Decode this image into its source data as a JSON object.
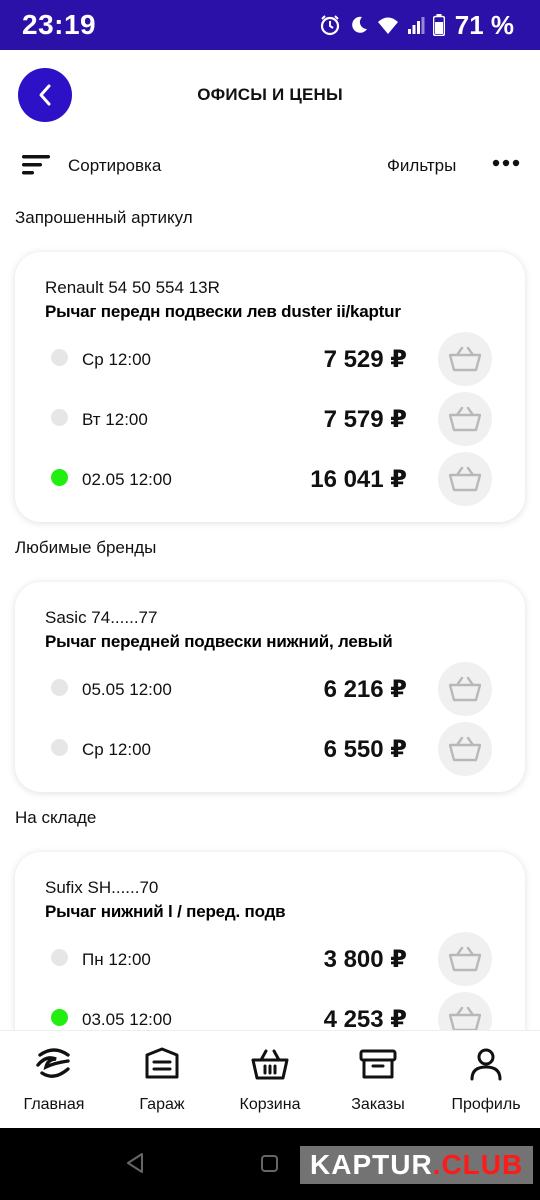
{
  "status_bar": {
    "time": "23:19",
    "battery_percent": "71 %"
  },
  "header": {
    "title": "ОФИСЫ И ЦЕНЫ"
  },
  "toolbar": {
    "sort_label": "Сортировка",
    "filters_label": "Фильтры"
  },
  "sections": [
    {
      "title": "Запрошенный артикул",
      "card": {
        "brand": "Renault 54 50 554 13R",
        "description": "Рычаг передн подвески лев duster ii/kaptur",
        "offers": [
          {
            "date": "Ср 12:00",
            "price": "7 529 ₽",
            "status": "grey"
          },
          {
            "date": "Вт 12:00",
            "price": "7 579 ₽",
            "status": "grey"
          },
          {
            "date": "02.05 12:00",
            "price": "16 041 ₽",
            "status": "green"
          }
        ]
      }
    },
    {
      "title": "Любимые бренды",
      "card": {
        "brand": "Sasic 74......77",
        "description": "Рычаг передней подвески нижний, левый",
        "offers": [
          {
            "date": "05.05 12:00",
            "price": "6 216 ₽",
            "status": "grey"
          },
          {
            "date": "Ср 12:00",
            "price": "6 550 ₽",
            "status": "grey"
          }
        ]
      }
    },
    {
      "title": "На складе",
      "card": {
        "brand": "Sufix SH......70",
        "description": "Рычаг нижний l / перед. подв",
        "offers": [
          {
            "date": "Пн 12:00",
            "price": "3 800 ₽",
            "status": "grey"
          },
          {
            "date": "03.05 12:00",
            "price": "4 253 ₽",
            "status": "green"
          }
        ]
      }
    }
  ],
  "bottom_nav": [
    {
      "label": "Главная",
      "icon": "home-logo-icon"
    },
    {
      "label": "Гараж",
      "icon": "garage-icon"
    },
    {
      "label": "Корзина",
      "icon": "basket-icon"
    },
    {
      "label": "Заказы",
      "icon": "orders-box-icon"
    },
    {
      "label": "Профиль",
      "icon": "profile-icon"
    }
  ],
  "watermark": {
    "part1": "KAPTUR",
    "part2": ".CLUB"
  },
  "colors": {
    "accent": "#2c11c6",
    "status_bar": "#2c11a8",
    "available_dot": "#22ee11",
    "unavailable_dot": "#e6e6e6"
  }
}
